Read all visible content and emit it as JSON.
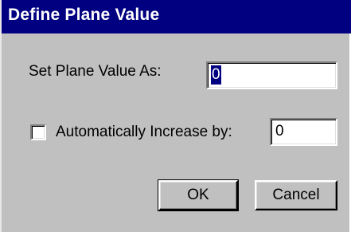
{
  "window": {
    "title": "Define Plane Value"
  },
  "plane_value": {
    "label": "Set Plane Value As:",
    "value": "0"
  },
  "auto_increase": {
    "label": "Automatically Increase by:",
    "checked": false,
    "value": "0"
  },
  "buttons": {
    "ok": "OK",
    "cancel": "Cancel"
  },
  "colors": {
    "titlebar": "#000080",
    "face": "#c0c0c0",
    "selection": "#000080"
  }
}
